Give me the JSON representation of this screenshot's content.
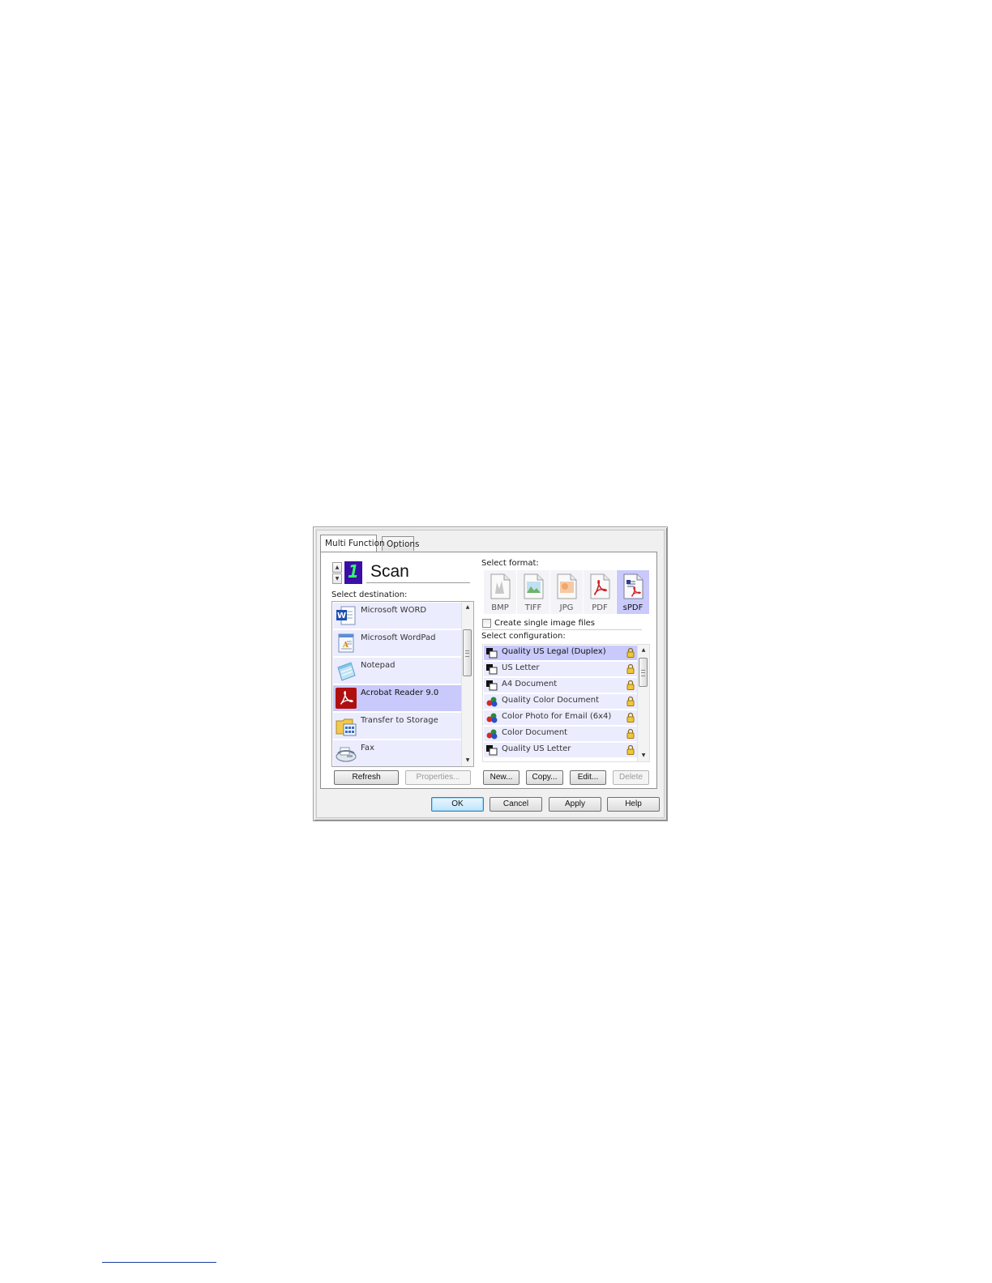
{
  "tabs": [
    {
      "label": "Multi Function",
      "active": true
    },
    {
      "label": "Options",
      "active": false
    }
  ],
  "button_number": "1",
  "button_name": "Scan",
  "destination": {
    "label": "Select destination:",
    "items": [
      {
        "label": "Microsoft WORD",
        "icon": "word-icon",
        "selected": false
      },
      {
        "label": "Microsoft WordPad",
        "icon": "wordpad-icon",
        "selected": false
      },
      {
        "label": "Notepad",
        "icon": "notepad-icon",
        "selected": false
      },
      {
        "label": "Acrobat Reader 9.0",
        "icon": "acrobat-icon",
        "selected": true
      },
      {
        "label": "Transfer to Storage",
        "icon": "storage-folder-icon",
        "selected": false
      },
      {
        "label": "Fax",
        "icon": "fax-icon",
        "selected": false
      }
    ],
    "refresh_label": "Refresh",
    "properties_label": "Properties..."
  },
  "format": {
    "label": "Select format:",
    "items": [
      {
        "label": "BMP",
        "icon": "bmp-file-icon",
        "selected": false
      },
      {
        "label": "TIFF",
        "icon": "tiff-file-icon",
        "selected": false
      },
      {
        "label": "JPG",
        "icon": "jpg-file-icon",
        "selected": false
      },
      {
        "label": "PDF",
        "icon": "pdf-file-icon",
        "selected": false
      },
      {
        "label": "sPDF",
        "icon": "spdf-file-icon",
        "selected": true
      }
    ],
    "single_image_label": "Create single image files",
    "single_image_checked": false
  },
  "configuration": {
    "label": "Select configuration:",
    "items": [
      {
        "label": "Quality US Legal (Duplex)",
        "color": false,
        "locked": true,
        "selected": true
      },
      {
        "label": "US Letter",
        "color": false,
        "locked": true,
        "selected": false
      },
      {
        "label": "A4 Document",
        "color": false,
        "locked": true,
        "selected": false
      },
      {
        "label": "Quality Color Document",
        "color": true,
        "locked": true,
        "selected": false
      },
      {
        "label": "Color Photo for Email (6x4)",
        "color": true,
        "locked": true,
        "selected": false
      },
      {
        "label": "Color Document",
        "color": true,
        "locked": true,
        "selected": false
      },
      {
        "label": "Quality US Letter",
        "color": false,
        "locked": true,
        "selected": false
      }
    ],
    "new_label": "New...",
    "copy_label": "Copy...",
    "edit_label": "Edit...",
    "delete_label": "Delete"
  },
  "footer": {
    "ok_label": "OK",
    "cancel_label": "Cancel",
    "apply_label": "Apply",
    "help_label": "Help"
  },
  "colors": {
    "selection": "#c9c9fb",
    "row": "#ececff",
    "button_number_bg": "#3b0fa6",
    "button_number_fg": "#33ff66"
  }
}
